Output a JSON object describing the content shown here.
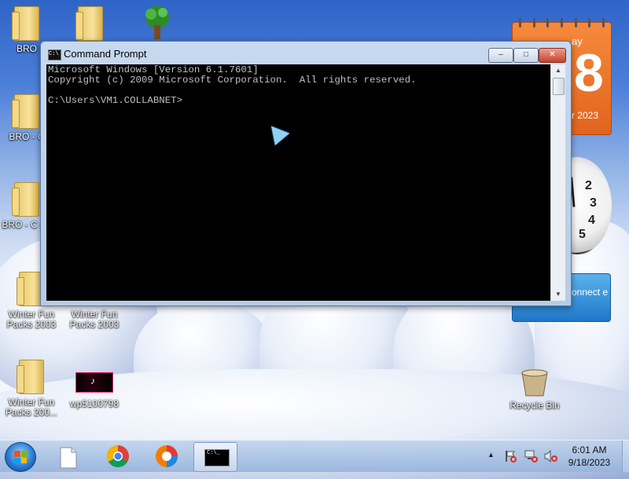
{
  "desktop": {
    "icons": [
      {
        "label": "BRO"
      },
      {
        "label": ""
      },
      {
        "label": ""
      },
      {
        "label": "BRO - C"
      },
      {
        "label": "BRO - C (2)"
      },
      {
        "label": "Winter Fun Packs 2003"
      },
      {
        "label": "Winter Fun Packs 2003"
      },
      {
        "label": "Winter Fun Packs 200..."
      },
      {
        "label": "wp5100798"
      },
      {
        "label": "Recycle Bin"
      }
    ]
  },
  "gadgets": {
    "calendar": {
      "day": "ay",
      "number": "8",
      "month": "r 2023"
    },
    "clock": {
      "numbers": [
        "2",
        "3",
        "4",
        "5"
      ]
    },
    "connect": {
      "label": "onnect e"
    }
  },
  "window": {
    "title": "Command Prompt",
    "console_text": "Microsoft Windows [Version 6.1.7601]\nCopyright (c) 2009 Microsoft Corporation.  All rights reserved.\n\nC:\\Users\\VM1.COLLABNET>",
    "buttons": {
      "minimize": "–",
      "maximize": "□",
      "close": "✕"
    }
  },
  "taskbar": {
    "clock": {
      "time": "6:01 AM",
      "date": "9/18/2023"
    },
    "tray_overflow": "▲",
    "active_app_glyph": "C:\\_"
  },
  "colors": {
    "accent": "#e1641d",
    "console_bg": "#000000",
    "console_fg": "#c0c0c0"
  }
}
